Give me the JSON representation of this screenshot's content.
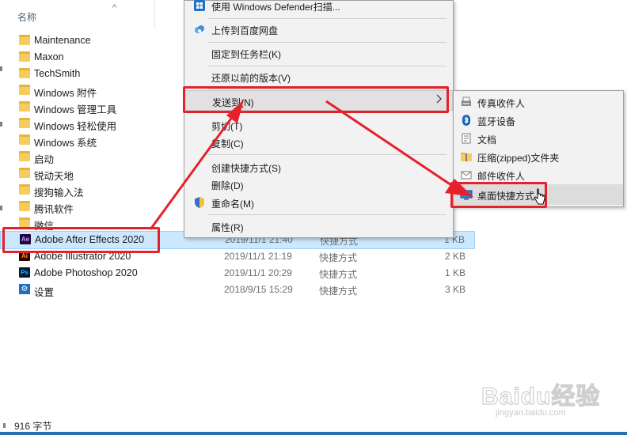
{
  "header": {
    "name_column": "名称",
    "sort_caret": "^"
  },
  "files": [
    {
      "name": "Maintenance",
      "kind": "folder"
    },
    {
      "name": "Maxon",
      "kind": "folder"
    },
    {
      "name": "TechSmith",
      "kind": "folder"
    },
    {
      "name": "Windows 附件",
      "kind": "folder"
    },
    {
      "name": "Windows 管理工具",
      "kind": "folder"
    },
    {
      "name": "Windows 轻松使用",
      "kind": "folder"
    },
    {
      "name": "Windows 系统",
      "kind": "folder"
    },
    {
      "name": "启动",
      "kind": "folder"
    },
    {
      "name": "锐动天地",
      "kind": "folder"
    },
    {
      "name": "搜狗输入法",
      "kind": "folder"
    },
    {
      "name": "腾讯软件",
      "kind": "folder"
    },
    {
      "name": "微信",
      "kind": "folder"
    },
    {
      "name": "Adobe After Effects 2020",
      "kind": "ae",
      "icon_text": "Ae",
      "date": "2019/11/1 21:40",
      "type": "快捷方式",
      "size": "1 KB",
      "selected": true
    },
    {
      "name": "Adobe Illustrator 2020",
      "kind": "ai",
      "icon_text": "Ai",
      "date": "2019/11/1 21:19",
      "type": "快捷方式",
      "size": "2 KB"
    },
    {
      "name": "Adobe Photoshop 2020",
      "kind": "ps",
      "icon_text": "Ps",
      "date": "2019/11/1 20:29",
      "type": "快捷方式",
      "size": "1 KB"
    },
    {
      "name": "设置",
      "kind": "settings",
      "icon_text": "⚙",
      "date": "2018/9/15 15:29",
      "type": "快捷方式",
      "size": "3 KB"
    }
  ],
  "context_menu": {
    "items": [
      {
        "label": "使用 Windows Defender扫描...",
        "icon": "windows-defender-icon"
      },
      {
        "label": "上传到百度网盘",
        "icon": "baidu-netdisk-icon"
      },
      {
        "label": "固定到任务栏(K)"
      },
      {
        "label": "还原以前的版本(V)"
      },
      {
        "label": "发送到(N)",
        "has_submenu": true,
        "highlighted": true
      },
      {
        "label": "剪切(T)"
      },
      {
        "label": "复制(C)"
      },
      {
        "label": "创建快捷方式(S)"
      },
      {
        "label": "删除(D)"
      },
      {
        "label": "重命名(M)",
        "icon": "uac-shield-icon"
      },
      {
        "label": "属性(R)"
      }
    ]
  },
  "send_to_submenu": {
    "items": [
      {
        "label": "传真收件人",
        "icon": "fax-icon"
      },
      {
        "label": "蓝牙设备",
        "icon": "bluetooth-icon"
      },
      {
        "label": "文档",
        "icon": "documents-icon"
      },
      {
        "label": "压缩(zipped)文件夹",
        "icon": "zip-folder-icon"
      },
      {
        "label": "邮件收件人",
        "icon": "mail-icon"
      },
      {
        "label": "桌面快捷方式",
        "icon": "desktop-icon",
        "highlighted": true
      }
    ]
  },
  "status_bar": {
    "text": "916 字节"
  },
  "watermark": {
    "logo_text": "Baidu经验",
    "url_text": "jingyan.baidu.com"
  },
  "colors": {
    "annotation_red": "#e5212b",
    "selection_blue": "#cce8ff",
    "menu_bg": "#f2f2f2"
  }
}
